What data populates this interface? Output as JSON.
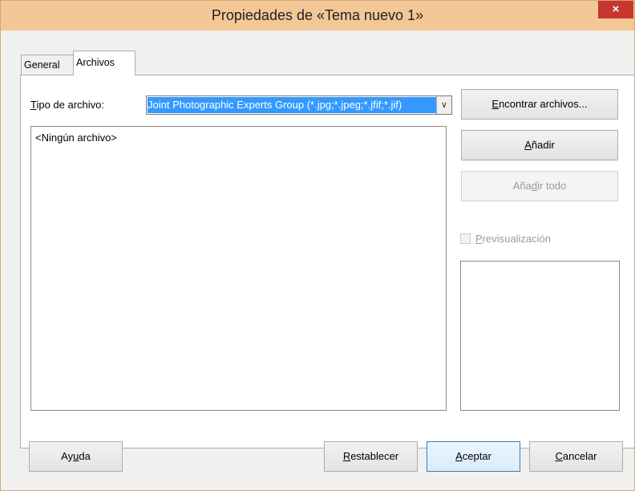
{
  "window": {
    "title": "Propiedades de «Tema nuevo 1»",
    "close_label": "×"
  },
  "tabs": [
    {
      "label": "General",
      "selected": false
    },
    {
      "label": "Archivos",
      "selected": true
    }
  ],
  "files_tab": {
    "file_type_label": {
      "mnemonic": "T",
      "rest": "ipo de archivo:"
    },
    "file_type_value": "Joint Photographic Experts Group (*.jpg;*.jpeg;*.jfif;*.jif)",
    "file_list_empty": "<Ningún archivo>",
    "find_button": {
      "mnemonic": "E",
      "rest": "ncontrar archivos..."
    },
    "add_button": {
      "mnemonic": "A",
      "rest": "ñadir"
    },
    "add_all_button": {
      "pre": "Aña",
      "mnemonic": "d",
      "rest": "ir todo",
      "enabled": false
    },
    "preview_checkbox": {
      "mnemonic": "P",
      "rest": "revisualización",
      "checked": false,
      "enabled": false
    }
  },
  "footer": {
    "help_button": {
      "pre": "Ay",
      "mnemonic": "u",
      "rest": "da"
    },
    "reset_button": {
      "mnemonic": "R",
      "rest": "establecer"
    },
    "ok_button": {
      "mnemonic": "A",
      "rest": "ceptar"
    },
    "cancel_button": {
      "mnemonic": "C",
      "rest": "ancelar"
    }
  },
  "icons": {
    "combo_arrow": "chevron-down-icon"
  },
  "colors": {
    "titlebar": "#f3c896",
    "close": "#c7372f",
    "selection": "#3399ff"
  }
}
